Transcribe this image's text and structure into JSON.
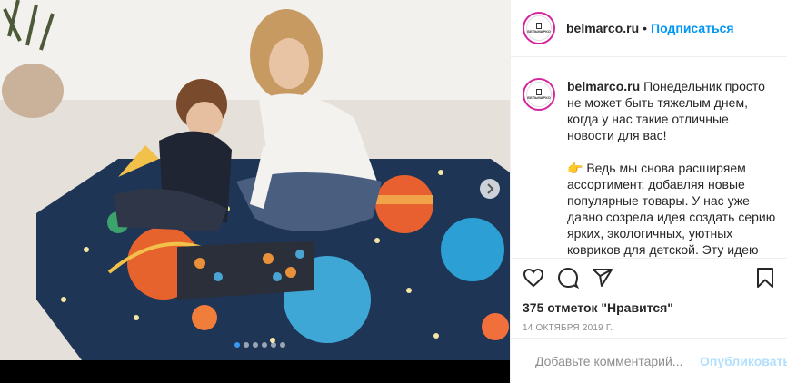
{
  "post": {
    "username": "belmarco.ru",
    "bullet": "•",
    "follow_label": "Подписаться",
    "avatar_text": "БЕЛЬМАРКО",
    "caption": {
      "username": "belmarco.ru",
      "para1": "Понедельник просто не может быть тяжелым днем, когда у нас такие отличные новости для вас!",
      "para2": "👉 Ведь мы снова расширяем ассортимент, добавляя новые популярные товары. У нас уже давно созрела идея создать серию ярких, экологичных, уютных ковриков для детской. Эту идею поддержали и наши клиенты."
    },
    "likes": "375 отметок \"Нравится\"",
    "date": "14 октября 2019 г.",
    "comment_placeholder": "Добавьте комментарий...",
    "post_button": "Опубликовать",
    "carousel": {
      "total": 6,
      "active": 1
    }
  },
  "icons": {
    "like": "heart-icon",
    "comment": "comment-bubble-icon",
    "share": "paper-plane-icon",
    "save": "bookmark-icon",
    "emoji": "smiley-icon",
    "next": "chevron-right-icon"
  },
  "colors": {
    "link_blue": "#0095f6",
    "post_disabled": "#b2dffc",
    "avatar_ring": "#d6249f",
    "carousel_active": "#3897f0"
  }
}
